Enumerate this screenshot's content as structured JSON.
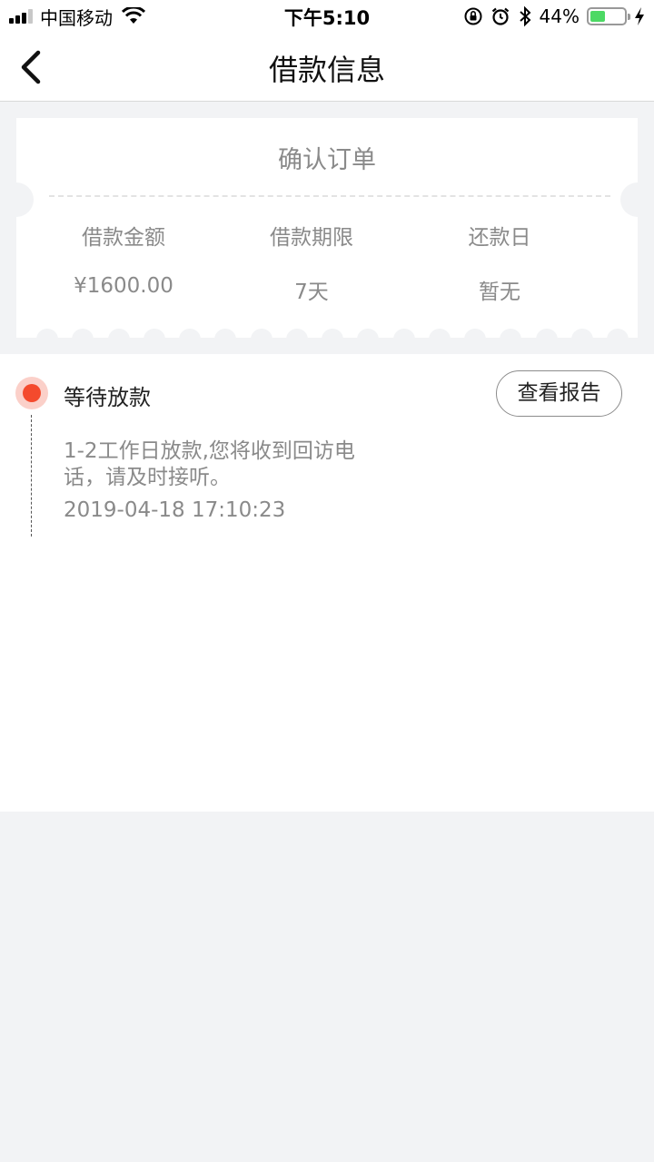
{
  "status_bar": {
    "carrier": "中国移动",
    "time": "下午5:10",
    "battery": "44%",
    "battery_level": 0.44
  },
  "nav": {
    "title": "借款信息"
  },
  "ticket": {
    "title": "确认订单",
    "columns": [
      {
        "label": "借款金额",
        "value": "¥1600.00"
      },
      {
        "label": "借款期限",
        "value": "7天"
      },
      {
        "label": "还款日",
        "value": "暂无"
      }
    ]
  },
  "status": {
    "title": "等待放款",
    "report_button": "查看报告",
    "description": "1-2工作日放款,您将收到回访电话，请及时接听。",
    "timestamp": "2019-04-18 17:10:23",
    "accent_color": "#f44a2d"
  },
  "colors": {
    "background": "#f2f3f5",
    "muted_text": "#8a8a8a",
    "battery_fill": "#4cd964"
  }
}
